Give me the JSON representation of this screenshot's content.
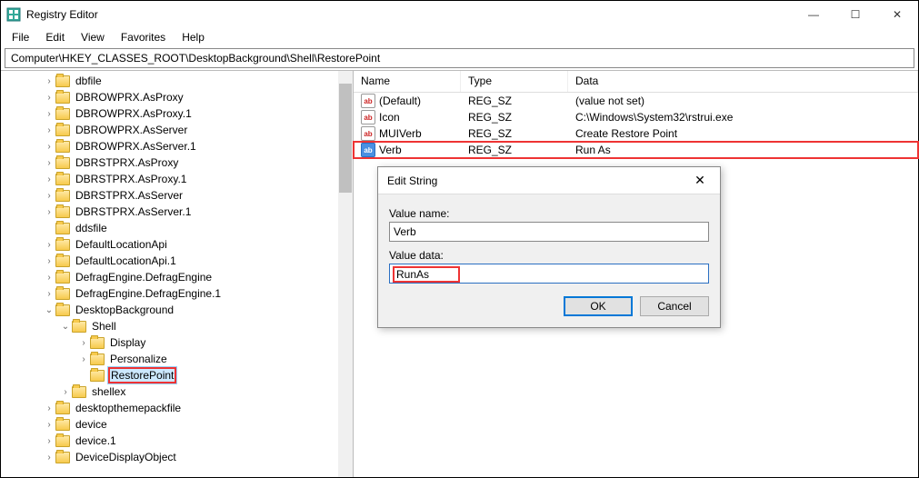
{
  "window": {
    "title": "Registry Editor",
    "minimize": "—",
    "maximize": "☐",
    "close": "✕"
  },
  "menu": {
    "file": "File",
    "edit": "Edit",
    "view": "View",
    "favorites": "Favorites",
    "help": "Help"
  },
  "address": "Computer\\HKEY_CLASSES_ROOT\\DesktopBackground\\Shell\\RestorePoint",
  "tree": [
    {
      "lvl": 1,
      "exp": ">",
      "label": "dbfile"
    },
    {
      "lvl": 1,
      "exp": ">",
      "label": "DBROWPRX.AsProxy"
    },
    {
      "lvl": 1,
      "exp": ">",
      "label": "DBROWPRX.AsProxy.1"
    },
    {
      "lvl": 1,
      "exp": ">",
      "label": "DBROWPRX.AsServer"
    },
    {
      "lvl": 1,
      "exp": ">",
      "label": "DBROWPRX.AsServer.1"
    },
    {
      "lvl": 1,
      "exp": ">",
      "label": "DBRSTPRX.AsProxy"
    },
    {
      "lvl": 1,
      "exp": ">",
      "label": "DBRSTPRX.AsProxy.1"
    },
    {
      "lvl": 1,
      "exp": ">",
      "label": "DBRSTPRX.AsServer"
    },
    {
      "lvl": 1,
      "exp": ">",
      "label": "DBRSTPRX.AsServer.1"
    },
    {
      "lvl": 1,
      "exp": "",
      "label": "ddsfile"
    },
    {
      "lvl": 1,
      "exp": ">",
      "label": "DefaultLocationApi"
    },
    {
      "lvl": 1,
      "exp": ">",
      "label": "DefaultLocationApi.1"
    },
    {
      "lvl": 1,
      "exp": ">",
      "label": "DefragEngine.DefragEngine"
    },
    {
      "lvl": 1,
      "exp": ">",
      "label": "DefragEngine.DefragEngine.1"
    },
    {
      "lvl": 1,
      "exp": "v",
      "label": "DesktopBackground"
    },
    {
      "lvl": 2,
      "exp": "v",
      "label": "Shell"
    },
    {
      "lvl": 3,
      "exp": ">",
      "label": "Display"
    },
    {
      "lvl": 3,
      "exp": ">",
      "label": "Personalize"
    },
    {
      "lvl": 3,
      "exp": "",
      "label": "RestorePoint",
      "hl": true,
      "sel": true
    },
    {
      "lvl": 2,
      "exp": ">",
      "label": "shellex"
    },
    {
      "lvl": 1,
      "exp": ">",
      "label": "desktopthemepackfile"
    },
    {
      "lvl": 1,
      "exp": ">",
      "label": "device"
    },
    {
      "lvl": 1,
      "exp": ">",
      "label": "device.1"
    },
    {
      "lvl": 1,
      "exp": ">",
      "label": "DeviceDisplayObject"
    }
  ],
  "list": {
    "headers": {
      "name": "Name",
      "type": "Type",
      "data": "Data"
    },
    "rows": [
      {
        "icon": "str",
        "name": "(Default)",
        "type": "REG_SZ",
        "data": "(value not set)"
      },
      {
        "icon": "str",
        "name": "Icon",
        "type": "REG_SZ",
        "data": "C:\\Windows\\System32\\rstrui.exe"
      },
      {
        "icon": "str",
        "name": "MUIVerb",
        "type": "REG_SZ",
        "data": "Create Restore Point"
      },
      {
        "icon": "sel",
        "name": "Verb",
        "type": "REG_SZ",
        "data": "Run As",
        "hl": true
      }
    ]
  },
  "dialog": {
    "title": "Edit String",
    "close": "✕",
    "name_label": "Value name:",
    "name_value": "Verb",
    "data_label": "Value data:",
    "data_value": "RunAs",
    "ok": "OK",
    "cancel": "Cancel"
  }
}
